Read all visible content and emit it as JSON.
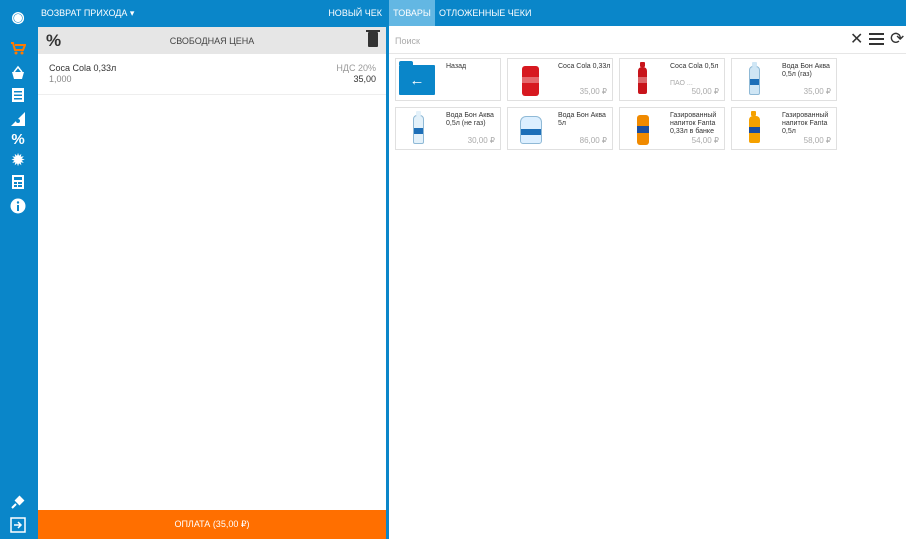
{
  "colors": {
    "accent": "#0a86c9",
    "orange": "#ff6f00",
    "active_tab": "#63b7e3",
    "white": "#ffffff"
  },
  "sidebar": {
    "icons": [
      "user-circle-icon",
      "cart-icon",
      "basket-icon",
      "list-icon",
      "chart-icon",
      "percent-icon",
      "gear-icon",
      "report-icon",
      "info-icon",
      "plugin-icon",
      "logout-icon"
    ]
  },
  "left_panel": {
    "mode_title": "ВОЗВРАТ ПРИХОДА ▾",
    "new_check": "НОВЫЙ ЧЕК",
    "percent_label": "%",
    "free_price": "СВОБОДНАЯ ЦЕНА",
    "items": [
      {
        "name": "Coca Cola 0,33л",
        "qty": "1,000",
        "vat": "НДС 20%",
        "sum": "35,00"
      }
    ],
    "pay_label": "ОПЛАТА (35,00 ₽)"
  },
  "right_panel": {
    "tabs": {
      "products": "ТОВАРЫ",
      "deferred": "ОТЛОЖЕННЫЕ ЧЕКИ"
    },
    "search": {
      "placeholder": "Поиск"
    },
    "clear_label": "✕",
    "refresh_label": "⟳",
    "back_arrow": "←",
    "products": [
      {
        "name": "Назад",
        "sub": "",
        "price": "",
        "kind": "back"
      },
      {
        "name": "Coca Cola 0,33л",
        "sub": "",
        "price": "35,00 ₽",
        "kind": "can-red"
      },
      {
        "name": "Coca Cola 0,5л",
        "sub": "ПАО ...",
        "price": "50,00 ₽",
        "kind": "bottle-red"
      },
      {
        "name": "Вода Бон Аква 0,5л (газ)",
        "sub": "",
        "price": "35,00 ₽",
        "kind": "bottle-water"
      },
      {
        "name": "Вода Бон Аква 0,5л (не газ)",
        "sub": "",
        "price": "30,00 ₽",
        "kind": "bottle-water"
      },
      {
        "name": "Вода Бон Аква 5л",
        "sub": "",
        "price": "86,00 ₽",
        "kind": "jug-water"
      },
      {
        "name": "Газированный напиток Fanta 0,33л в банке",
        "sub": "",
        "price": "54,00 ₽",
        "kind": "can-orange"
      },
      {
        "name": "Газированный напиток Fanta 0,5л",
        "sub": "",
        "price": "58,00 ₽",
        "kind": "bottle-orange"
      }
    ]
  }
}
